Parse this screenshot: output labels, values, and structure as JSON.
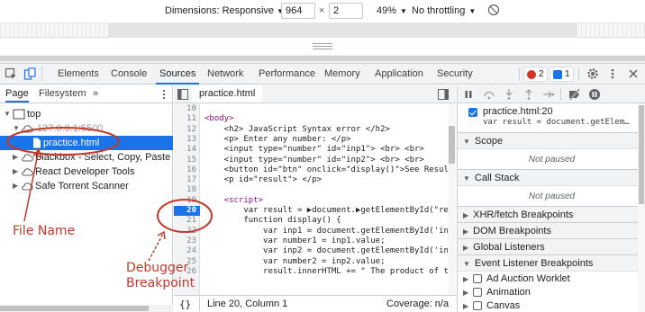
{
  "device_toolbar": {
    "dimensions_label": "Dimensions: Responsive",
    "width_value": "964",
    "times": "×",
    "height_value": "2",
    "zoom": "49%",
    "throttle": "No throttling"
  },
  "devtools_tabs": [
    "Elements",
    "Console",
    "Sources",
    "Network",
    "Performance",
    "Memory",
    "Application",
    "Security"
  ],
  "active_tab": "Sources",
  "badges": {
    "errors": "2",
    "messages": "1",
    "error_color": "#d93025",
    "message_color": "#1a73e8"
  },
  "navigator": {
    "tabs": [
      "Page",
      "Filesystem"
    ],
    "more": "»",
    "tree": [
      {
        "label": "top",
        "level": 0
      },
      {
        "label": "127.0.0.1:5500",
        "level": 1
      },
      {
        "label": "practice.html",
        "level": 2,
        "selected": true
      },
      {
        "label": "Blackbox - Select, Copy, Paste & Se",
        "level": 1
      },
      {
        "label": "React Developer Tools",
        "level": 1
      },
      {
        "label": "Safe Torrent Scanner",
        "level": 1
      }
    ]
  },
  "editor": {
    "file_tab": "practice.html",
    "status": "Line 20, Column 1",
    "coverage": "Coverage: n/a",
    "format_icon": "{}",
    "breakpoint_line": "20",
    "line_numbers": [
      "10",
      "11",
      "12",
      "13",
      "14",
      "15",
      "16",
      "17",
      "18",
      "19",
      "20",
      "21",
      "22",
      "23",
      "24",
      "25",
      "26"
    ],
    "code_lines": [
      "",
      "<body>",
      "    <h2> JavaScript Syntax error </h2>",
      "    <p> Enter any number: </p>",
      "    <input type=\"number\" id=\"inp1\"> <br> <br>",
      "    <input type=\"number\" id=\"inp2\"> <br> <br>",
      "    <button id=\"btn\" onclick=\"display()\">See Result",
      "    <p id=\"result\"> </p>",
      "",
      "    <script>",
      "        var result = ▶document.▶getElementById(\"re",
      "        function display() {",
      "            var inp1 = document.getElementById('in",
      "            var number1 = inp1.value;",
      "            var inp2 = document.getElementById('in",
      "            var number2 = inp2.value;",
      "            result.innerHTML += \" The product of t"
    ]
  },
  "debugger": {
    "breakpoint_file": "practice.html:20",
    "breakpoint_code": "var result = document.getElem…",
    "scope": "Scope",
    "call_stack": "Call Stack",
    "not_paused": "Not paused",
    "sections": [
      "XHR/fetch Breakpoints",
      "DOM Breakpoints",
      "Global Listeners",
      "Event Listener Breakpoints"
    ],
    "events": [
      "Ad Auction Worklet",
      "Animation",
      "Canvas"
    ]
  },
  "annotations": {
    "file_name": "File Name",
    "debugger_breakpoint_1": "Debugger",
    "debugger_breakpoint_2": "Breakpoint",
    "color": "#c0392b"
  }
}
